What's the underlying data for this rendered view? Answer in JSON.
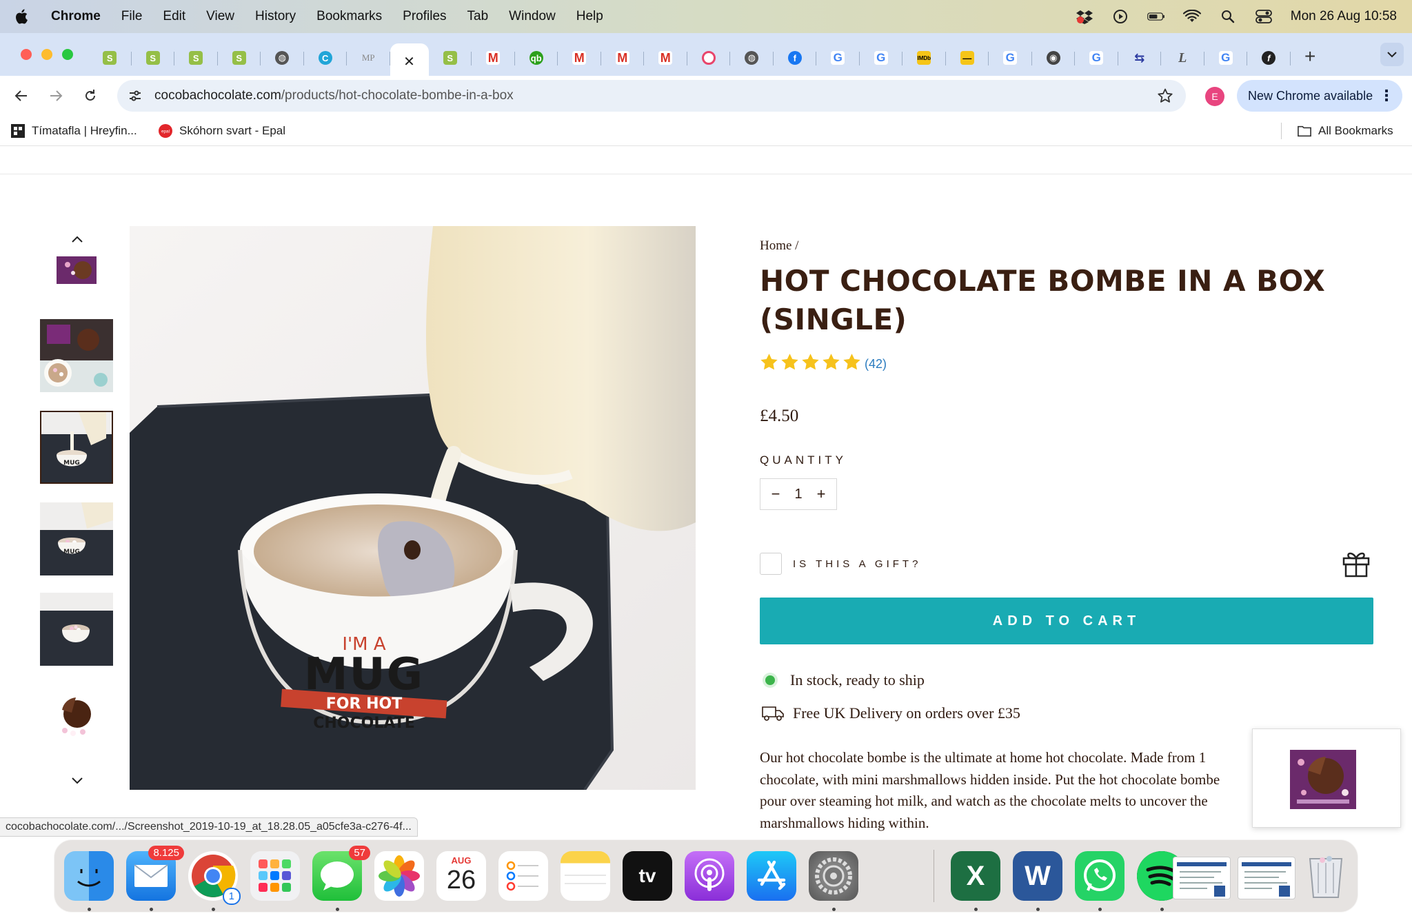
{
  "menubar": {
    "app": "Chrome",
    "items": [
      "File",
      "Edit",
      "View",
      "History",
      "Bookmarks",
      "Profiles",
      "Tab",
      "Window",
      "Help"
    ],
    "clock": "Mon 26 Aug  10:58"
  },
  "browser": {
    "close_tab_glyph": "✕",
    "new_tab_glyph": "+",
    "url_host": "cocobachocolate.com",
    "url_path": "/products/hot-chocolate-bombe-in-a-box",
    "profile_initial": "E",
    "update_label": "New Chrome available",
    "bookmarks": [
      {
        "label": "Tímatafla | Hreyfin...",
        "icon": "grid-icon"
      },
      {
        "label": "Skóhorn svart - Epal",
        "icon": "epal-icon"
      }
    ],
    "all_bookmarks": "All Bookmarks",
    "status_url": "cocobachocolate.com/.../Screenshot_2019-10-19_at_18.28.05_a05cfe3a-c276-4f..."
  },
  "product": {
    "breadcrumb": "Home /",
    "title": "HOT CHOCOLATE BOMBE IN A BOX (SINGLE)",
    "rating": 5,
    "reviews": "(42)",
    "price": "£4.50",
    "quantity_label": "QUANTITY",
    "quantity": "1",
    "minus": "−",
    "plus": "+",
    "gift_label": "IS THIS A GIFT?",
    "add_to_cart": "ADD TO CART",
    "stock": "In stock, ready to ship",
    "delivery": "Free UK Delivery on orders over £35",
    "description_lines": [
      "Our hot chocolate bombe is the ultimate at home hot chocolate. Made from 1",
      "chocolate, with mini marshmallows hidden inside. Put the hot chocolate bombe",
      "pour over steaming hot milk, and watch as the chocolate melts to uncover the",
      "marshmallows hiding within."
    ],
    "main_image_text": [
      "I'M A",
      "MUG",
      "FOR HOT",
      "CHOCOLATE"
    ]
  },
  "dock": {
    "mail_badge": "8.125",
    "chrome_badge": "1",
    "messages_badge": "57",
    "calendar_month": "AUG",
    "calendar_day": "26",
    "tv_label": "tv",
    "excel_letter": "X",
    "word_letter": "W"
  },
  "colors": {
    "brand_brown": "#3a1f12",
    "cart_teal": "#19abb3",
    "star_gold": "#f6c21c",
    "stock_green": "#3cb44b"
  }
}
